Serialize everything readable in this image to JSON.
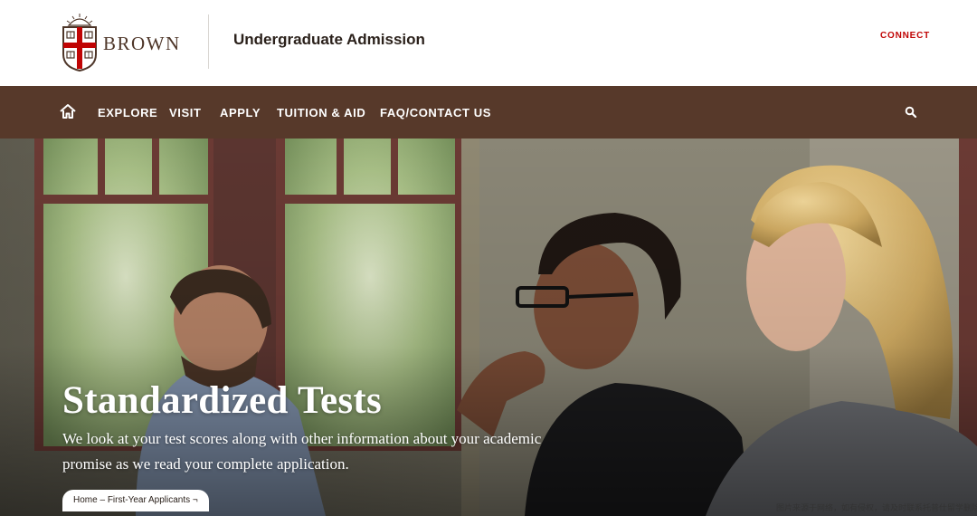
{
  "header": {
    "logo_word": "BROWN",
    "site_title": "Undergraduate Admission",
    "connect_label": "CONNECT"
  },
  "nav": {
    "home_icon": "home-icon",
    "items": [
      {
        "label": "EXPLORE"
      },
      {
        "label": "VISIT"
      },
      {
        "label": "APPLY"
      },
      {
        "label": "TUITION & AID"
      },
      {
        "label": "FAQ/CONTACT US"
      }
    ],
    "search_icon": "search-icon"
  },
  "hero": {
    "title": "Standardized Tests",
    "subtitle": "We look at your test scores along with other information about your academic promise as we read your complete application.",
    "breadcrumb": {
      "home": "Home",
      "separator": " – ",
      "current": "First-Year Applicants",
      "chevron": " ¬"
    }
  },
  "watermark": "图片来源于网络，如有侵权，请及时联系托普仕留学删除",
  "colors": {
    "brand_brown": "#4e3629",
    "nav_brown": "#57392a",
    "brand_red": "#c00404"
  }
}
